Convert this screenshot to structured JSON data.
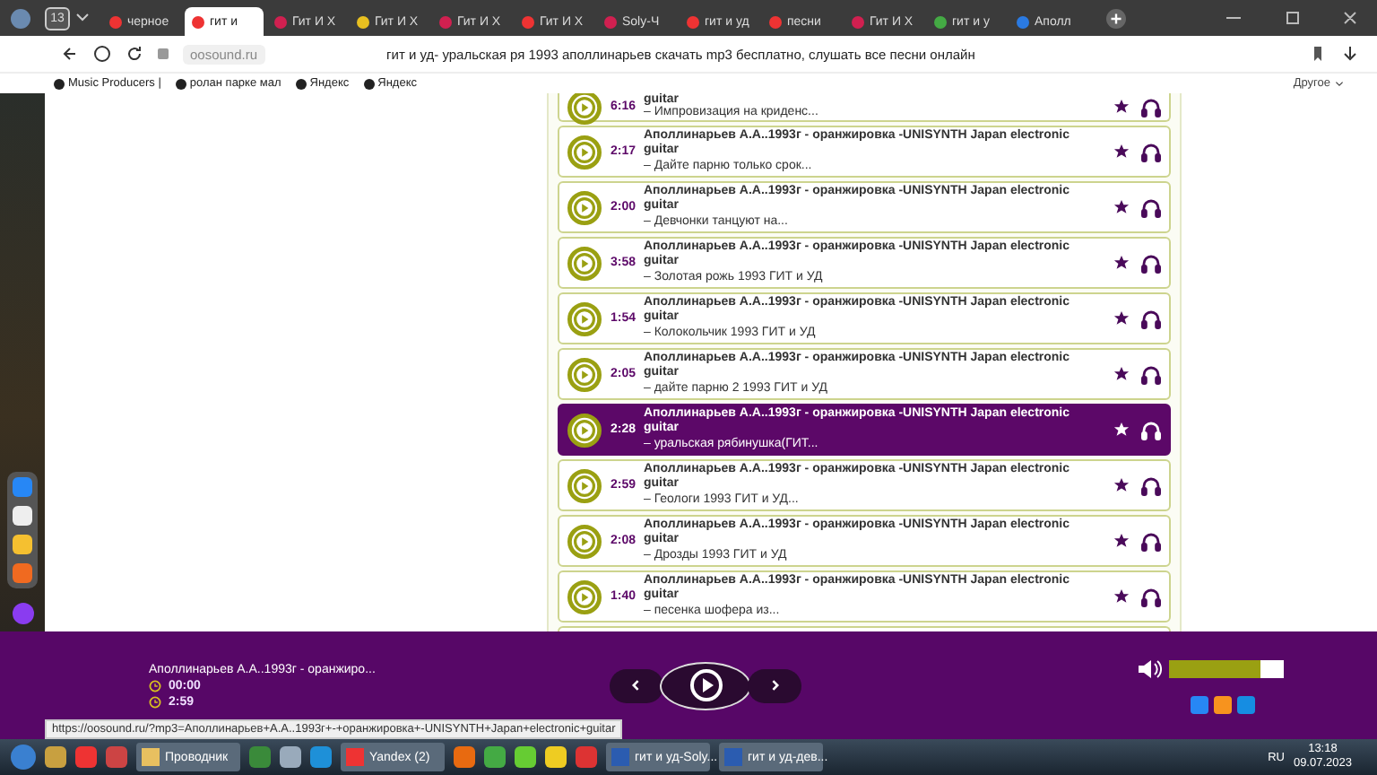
{
  "browser": {
    "tab_count": "13",
    "tabs": [
      {
        "label": "черное",
        "selected": false
      },
      {
        "label": "гит и",
        "selected": true
      },
      {
        "label": "Гит И Х",
        "selected": false
      },
      {
        "label": "Гит И Х",
        "selected": false
      },
      {
        "label": "Гит И Х",
        "selected": false
      },
      {
        "label": "Гит И Х",
        "selected": false
      },
      {
        "label": "Solу-Ч",
        "selected": false
      },
      {
        "label": "гит и уд",
        "selected": false
      },
      {
        "label": "песни",
        "selected": false
      },
      {
        "label": "Гит И Х",
        "selected": false
      },
      {
        "label": "гит и у",
        "selected": false
      },
      {
        "label": "Аполл",
        "selected": false
      }
    ],
    "address": "oosound.ru",
    "page_title": "гит и уд- уральская ря 1993 аполлинарьев скачать mp3 бесплатно, слушать все песни онлайн",
    "bookmarks": [
      "Music Producers |",
      "ролан парке мал",
      "Яндекс",
      "Яндекс"
    ],
    "bookmarks_more": "Другое"
  },
  "tracks": [
    {
      "kind": "top-cut",
      "duration": "6:16",
      "title": "guitar",
      "subtitle": "– Импровизация на криденс...",
      "selected": false
    },
    {
      "kind": "full",
      "duration": "2:17",
      "title": "Аполлинарьев А.А..1993г - оранжировка -UNISYNTH Japan electronic guitar",
      "subtitle": "– Дайте парню только срок...",
      "selected": false
    },
    {
      "kind": "full",
      "duration": "2:00",
      "title": "Аполлинарьев А.А..1993г - оранжировка -UNISYNTH Japan electronic guitar",
      "subtitle": "– Девчонки танцуют на...",
      "selected": false
    },
    {
      "kind": "full",
      "duration": "3:58",
      "title": "Аполлинарьев А.А..1993г - оранжировка -UNISYNTH Japan electronic guitar",
      "subtitle": "– Золотая рожь 1993 ГИТ и УД",
      "selected": false
    },
    {
      "kind": "full",
      "duration": "1:54",
      "title": "Аполлинарьев А.А..1993г - оранжировка -UNISYNTH Japan electronic guitar",
      "subtitle": "– Колокольчик 1993 ГИТ и УД",
      "selected": false
    },
    {
      "kind": "full",
      "duration": "2:05",
      "title": "Аполлинарьев А.А..1993г - оранжировка -UNISYNTH Japan electronic guitar",
      "subtitle": "– дайте парню 2 1993 ГИТ и УД",
      "selected": false
    },
    {
      "kind": "full",
      "duration": "2:28",
      "title": "Аполлинарьев А.А..1993г - оранжировка -UNISYNTH Japan electronic guitar",
      "subtitle": "– уральская рябинушка(ГИТ...",
      "selected": true
    },
    {
      "kind": "full",
      "duration": "2:59",
      "title": "Аполлинарьев А.А..1993г - оранжировка -UNISYNTH Japan electronic guitar",
      "subtitle": "– Геологи 1993 ГИТ и УД...",
      "selected": false
    },
    {
      "kind": "full",
      "duration": "2:08",
      "title": "Аполлинарьев А.А..1993г - оранжировка -UNISYNTH Japan electronic guitar",
      "subtitle": "– Дрозды 1993 ГИТ и УД",
      "selected": false
    },
    {
      "kind": "full",
      "duration": "1:40",
      "title": "Аполлинарьев А.А..1993г - оранжировка -UNISYNTH Japan electronic guitar",
      "subtitle": "– песенка шофера из...",
      "selected": false
    },
    {
      "kind": "bottom-cut",
      "selected": false
    }
  ],
  "player": {
    "now_playing": "Аполлинарьев А.А..1993г - оранжиро...",
    "elapsed": "00:00",
    "total": "2:59",
    "volume": {
      "level": 0.8
    }
  },
  "status_url": "https://oosound.ru/?mp3=Аполлинарьев+А.А..1993г+-+оранжировка+-UNISYNTH+Japan+electronic+guitar",
  "taskbar": {
    "items": [
      {
        "label": "Проводник"
      },
      {
        "label": "Yandex (2)"
      },
      {
        "label": "гит и уд-Soly..."
      },
      {
        "label": "гит и уд-дев..."
      }
    ],
    "language": "RU",
    "time": "13:18",
    "date": "09.07.2023"
  }
}
